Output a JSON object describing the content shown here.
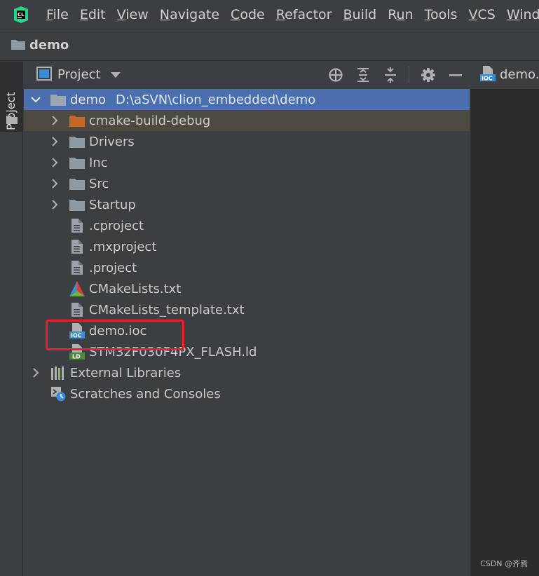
{
  "menubar": {
    "logo_text": "CL",
    "items": [
      "File",
      "Edit",
      "View",
      "Navigate",
      "Code",
      "Refactor",
      "Build",
      "Run",
      "Tools",
      "VCS",
      "Windo"
    ],
    "underline_index": [
      0,
      0,
      0,
      0,
      0,
      0,
      0,
      1,
      0,
      0,
      0
    ]
  },
  "navbar": {
    "title": "demo",
    "icon": "folder-icon"
  },
  "toolstrip": {
    "tab_label": "Project"
  },
  "panel": {
    "title": "Project",
    "actions": [
      "locate-icon",
      "expand-all-icon",
      "collapse-all-icon",
      "gear-icon",
      "minimize-icon"
    ]
  },
  "tree": {
    "root_label": "demo",
    "root_path": "D:\\aSVN\\clion_embedded\\demo",
    "items": [
      {
        "label": "cmake-build-debug",
        "icon": "folder-orange-icon",
        "expandable": true
      },
      {
        "label": "Drivers",
        "icon": "folder-icon",
        "expandable": true
      },
      {
        "label": "Inc",
        "icon": "folder-icon",
        "expandable": true
      },
      {
        "label": "Src",
        "icon": "folder-icon",
        "expandable": true
      },
      {
        "label": "Startup",
        "icon": "folder-icon",
        "expandable": true
      },
      {
        "label": ".cproject",
        "icon": "file-icon",
        "expandable": false
      },
      {
        "label": ".mxproject",
        "icon": "file-icon",
        "expandable": false
      },
      {
        "label": ".project",
        "icon": "file-icon",
        "expandable": false
      },
      {
        "label": "CMakeLists.txt",
        "icon": "cmake-icon",
        "expandable": false
      },
      {
        "label": "CMakeLists_template.txt",
        "icon": "file-icon",
        "expandable": false
      },
      {
        "label": "demo.ioc",
        "icon": "ioc-file-icon",
        "expandable": false
      },
      {
        "label": "STM32F030F4PX_FLASH.ld",
        "icon": "ld-file-icon",
        "expandable": false
      }
    ],
    "external_libraries": "External Libraries",
    "scratches": "Scratches and Consoles"
  },
  "editor": {
    "tab_label": "demo.ioc",
    "badge": "IOC"
  },
  "watermark": "CSDN @齐焉",
  "colors": {
    "selected_row": "#4b6eaf",
    "excluded_row": "#4d4a42",
    "highlight": "#e8222b",
    "folder": "#8f9aa3",
    "orange_folder": "#c4672d"
  }
}
